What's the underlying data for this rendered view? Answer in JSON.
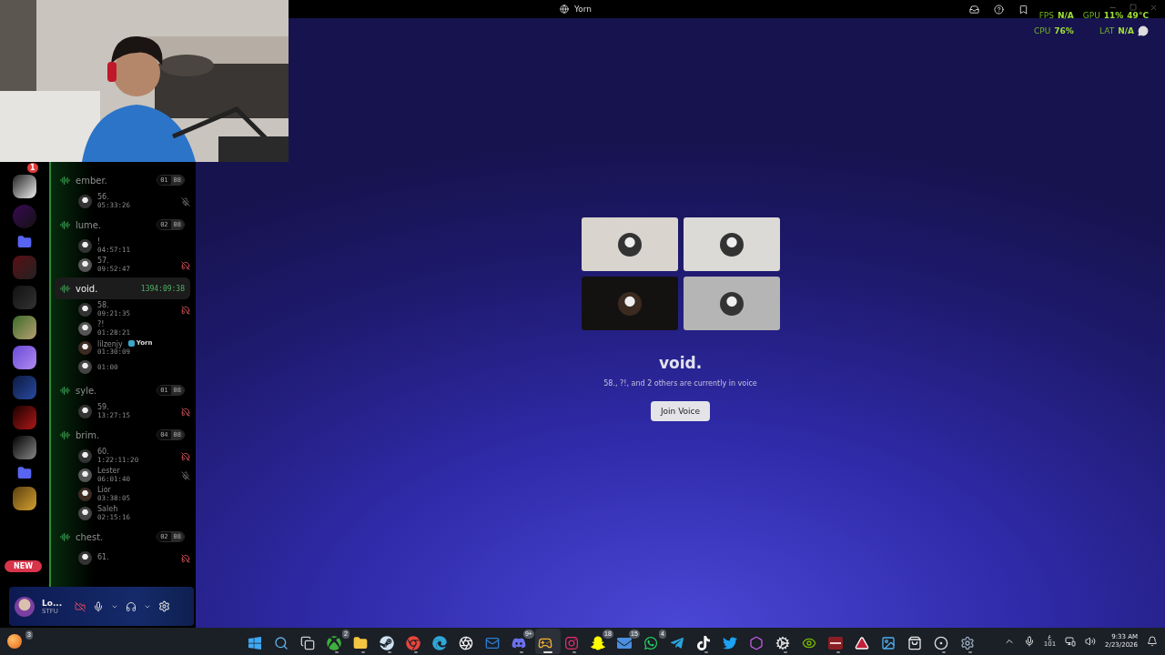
{
  "window": {
    "title": "Yorn"
  },
  "overlay_stats": {
    "fps_label": "FPS",
    "fps": "N/A",
    "gpu_label": "GPU",
    "gpu": "11%",
    "gpu_temp": "49°C",
    "cpu_label": "CPU",
    "cpu": "76%",
    "lat_label": "LAT",
    "lat": "N/A"
  },
  "servers": {
    "top_badge": "1",
    "new_badge": "NEW"
  },
  "channels": [
    {
      "name": "ember.",
      "selected": false,
      "count": "01",
      "limit": "08",
      "members": [
        {
          "name": "56.",
          "time": "05:33:26",
          "deafened": false,
          "muted": true
        }
      ]
    },
    {
      "name": "lume.",
      "selected": false,
      "count": "02",
      "limit": "08",
      "members": [
        {
          "name": "!",
          "time": "04:57:11",
          "deafened": false,
          "muted": false
        },
        {
          "name": "57.",
          "time": "09:52:47",
          "deafened": true,
          "muted": false
        }
      ]
    },
    {
      "name": "void.",
      "selected": true,
      "timer": "1394:09:38",
      "members": [
        {
          "name": "58.",
          "time": "09:21:35",
          "deafened": true,
          "muted": false
        },
        {
          "name": "?!",
          "time": "01:28:21",
          "deafened": false,
          "muted": false
        },
        {
          "name": "lilzenjy",
          "time": "01:30:09",
          "tag": "Yorn",
          "deafened": false,
          "muted": false
        },
        {
          "time": "01:00",
          "deafened": false,
          "muted": false
        }
      ]
    },
    {
      "name": "syle.",
      "selected": false,
      "count": "01",
      "limit": "08",
      "members": [
        {
          "name": "59.",
          "time": "13:27:15",
          "deafened": true,
          "muted": false
        }
      ]
    },
    {
      "name": "brim.",
      "selected": false,
      "count": "04",
      "limit": "08",
      "members": [
        {
          "name": "60.",
          "time": "1:22:11:20",
          "deafened": true,
          "muted": false
        },
        {
          "name": "Lester",
          "time": "06:01:40",
          "deafened": false,
          "muted": true
        },
        {
          "name": "Lior",
          "time": "03:38:05",
          "deafened": false,
          "muted": false
        },
        {
          "name": "Saleh",
          "time": "02:15:16",
          "deafened": false,
          "muted": false
        }
      ]
    },
    {
      "name": "chest.",
      "selected": false,
      "count": "02",
      "limit": "08",
      "members": [
        {
          "name": "61.",
          "deafened": true,
          "muted": false
        }
      ]
    }
  ],
  "user_panel": {
    "name": "Lo...",
    "status": "STFU",
    "camera_off": true
  },
  "main": {
    "tiles": [
      {
        "color": "#d9d4ce"
      },
      {
        "color": "#dcdad6"
      },
      {
        "color": "#141210"
      },
      {
        "color": "#b5b5b5"
      }
    ],
    "title": "void.",
    "subtitle": "58., ?!, and 2 others are currently in voice",
    "button": "Join Voice"
  },
  "taskbar": {
    "corner_badge": "3",
    "apps": [
      {
        "kind": "windows",
        "running": false,
        "selected": false
      },
      {
        "kind": "search",
        "running": false,
        "selected": false
      },
      {
        "kind": "taskview",
        "running": false,
        "selected": false
      },
      {
        "kind": "xbox",
        "running": true,
        "selected": false,
        "badge": "2"
      },
      {
        "kind": "files",
        "running": true,
        "selected": false
      },
      {
        "kind": "steam",
        "running": true,
        "selected": false
      },
      {
        "kind": "chrome",
        "running": true,
        "selected": false
      },
      {
        "kind": "edge",
        "running": false,
        "selected": false
      },
      {
        "kind": "aperture",
        "running": false,
        "selected": false
      },
      {
        "kind": "outlook",
        "running": false,
        "selected": false
      },
      {
        "kind": "discord",
        "running": true,
        "selected": false,
        "badge": "9+"
      },
      {
        "kind": "chat",
        "running": true,
        "selected": true
      },
      {
        "kind": "instagram",
        "running": true,
        "selected": false
      },
      {
        "kind": "snapchat",
        "running": false,
        "selected": false,
        "badge": "18"
      },
      {
        "kind": "mail",
        "running": false,
        "selected": false,
        "badge": "15"
      },
      {
        "kind": "whatsapp",
        "running": false,
        "selected": false,
        "badge": "4"
      },
      {
        "kind": "telegram",
        "running": false,
        "selected": false
      },
      {
        "kind": "tiktok",
        "running": true,
        "selected": false
      },
      {
        "kind": "twitter",
        "running": false,
        "selected": false
      },
      {
        "kind": "office",
        "running": false,
        "selected": false
      },
      {
        "kind": "gear",
        "running": true,
        "selected": false
      },
      {
        "kind": "nvidia",
        "running": false,
        "selected": false
      },
      {
        "kind": "mixer",
        "running": true,
        "selected": false
      },
      {
        "kind": "triangle",
        "running": false,
        "selected": false
      },
      {
        "kind": "photos",
        "running": false,
        "selected": false
      },
      {
        "kind": "store",
        "running": false,
        "selected": false
      },
      {
        "kind": "record",
        "running": true,
        "selected": false
      },
      {
        "kind": "settings",
        "running": true,
        "selected": false
      }
    ],
    "language": "ع",
    "layout": "101",
    "time": "9:33 AM",
    "date": "2/23/2026"
  }
}
